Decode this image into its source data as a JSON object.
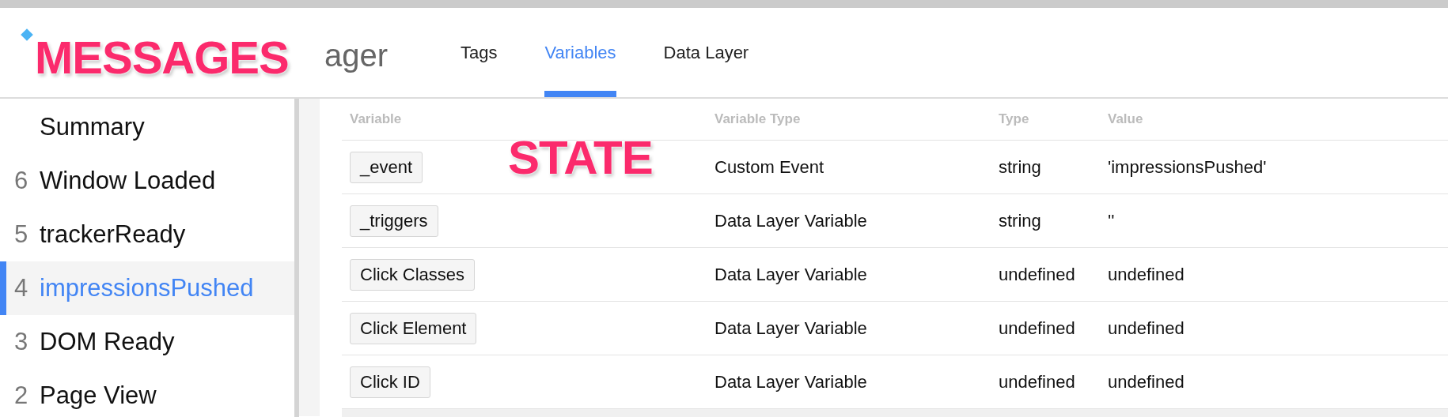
{
  "header": {
    "logo_text": "ager",
    "tabs": [
      {
        "label": "Tags",
        "selected": false
      },
      {
        "label": "Variables",
        "selected": true
      },
      {
        "label": "Data Layer",
        "selected": false
      }
    ]
  },
  "sidebar": {
    "items": [
      {
        "label": "Summary",
        "selected": false
      },
      {
        "number": "6",
        "label": "Window Loaded",
        "selected": false
      },
      {
        "number": "5",
        "label": "trackerReady",
        "selected": false
      },
      {
        "number": "4",
        "label": "impressionsPushed",
        "selected": true
      },
      {
        "number": "3",
        "label": "DOM Ready",
        "selected": false
      },
      {
        "number": "2",
        "label": "Page View",
        "selected": false
      }
    ]
  },
  "table": {
    "columns": [
      "Variable",
      "Variable Type",
      "Type",
      "Value"
    ],
    "rows": [
      {
        "variable": "_event",
        "variable_type": "Custom Event",
        "return_type": "string",
        "value": "'impressionsPushed'"
      },
      {
        "variable": "_triggers",
        "variable_type": "Data Layer Variable",
        "return_type": "string",
        "value": "''"
      },
      {
        "variable": "Click Classes",
        "variable_type": "Data Layer Variable",
        "return_type": "undefined",
        "value": "undefined"
      },
      {
        "variable": "Click Element",
        "variable_type": "Data Layer Variable",
        "return_type": "undefined",
        "value": "undefined"
      },
      {
        "variable": "Click ID",
        "variable_type": "Data Layer Variable",
        "return_type": "undefined",
        "value": "undefined"
      }
    ]
  },
  "annotations": [
    {
      "text": "MESSAGES"
    },
    {
      "text": "STATE"
    }
  ]
}
